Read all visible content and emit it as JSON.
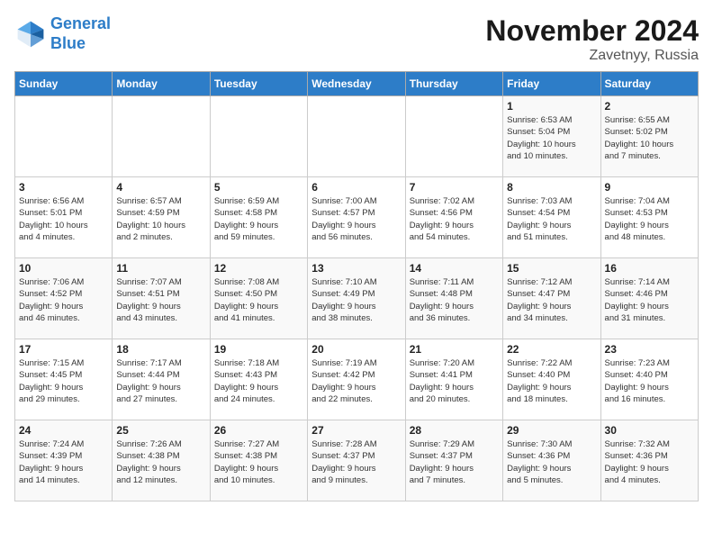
{
  "header": {
    "logo_line1": "General",
    "logo_line2": "Blue",
    "month": "November 2024",
    "location": "Zavetnyy, Russia"
  },
  "weekdays": [
    "Sunday",
    "Monday",
    "Tuesday",
    "Wednesday",
    "Thursday",
    "Friday",
    "Saturday"
  ],
  "weeks": [
    [
      {
        "day": "",
        "info": ""
      },
      {
        "day": "",
        "info": ""
      },
      {
        "day": "",
        "info": ""
      },
      {
        "day": "",
        "info": ""
      },
      {
        "day": "",
        "info": ""
      },
      {
        "day": "1",
        "info": "Sunrise: 6:53 AM\nSunset: 5:04 PM\nDaylight: 10 hours\nand 10 minutes."
      },
      {
        "day": "2",
        "info": "Sunrise: 6:55 AM\nSunset: 5:02 PM\nDaylight: 10 hours\nand 7 minutes."
      }
    ],
    [
      {
        "day": "3",
        "info": "Sunrise: 6:56 AM\nSunset: 5:01 PM\nDaylight: 10 hours\nand 4 minutes."
      },
      {
        "day": "4",
        "info": "Sunrise: 6:57 AM\nSunset: 4:59 PM\nDaylight: 10 hours\nand 2 minutes."
      },
      {
        "day": "5",
        "info": "Sunrise: 6:59 AM\nSunset: 4:58 PM\nDaylight: 9 hours\nand 59 minutes."
      },
      {
        "day": "6",
        "info": "Sunrise: 7:00 AM\nSunset: 4:57 PM\nDaylight: 9 hours\nand 56 minutes."
      },
      {
        "day": "7",
        "info": "Sunrise: 7:02 AM\nSunset: 4:56 PM\nDaylight: 9 hours\nand 54 minutes."
      },
      {
        "day": "8",
        "info": "Sunrise: 7:03 AM\nSunset: 4:54 PM\nDaylight: 9 hours\nand 51 minutes."
      },
      {
        "day": "9",
        "info": "Sunrise: 7:04 AM\nSunset: 4:53 PM\nDaylight: 9 hours\nand 48 minutes."
      }
    ],
    [
      {
        "day": "10",
        "info": "Sunrise: 7:06 AM\nSunset: 4:52 PM\nDaylight: 9 hours\nand 46 minutes."
      },
      {
        "day": "11",
        "info": "Sunrise: 7:07 AM\nSunset: 4:51 PM\nDaylight: 9 hours\nand 43 minutes."
      },
      {
        "day": "12",
        "info": "Sunrise: 7:08 AM\nSunset: 4:50 PM\nDaylight: 9 hours\nand 41 minutes."
      },
      {
        "day": "13",
        "info": "Sunrise: 7:10 AM\nSunset: 4:49 PM\nDaylight: 9 hours\nand 38 minutes."
      },
      {
        "day": "14",
        "info": "Sunrise: 7:11 AM\nSunset: 4:48 PM\nDaylight: 9 hours\nand 36 minutes."
      },
      {
        "day": "15",
        "info": "Sunrise: 7:12 AM\nSunset: 4:47 PM\nDaylight: 9 hours\nand 34 minutes."
      },
      {
        "day": "16",
        "info": "Sunrise: 7:14 AM\nSunset: 4:46 PM\nDaylight: 9 hours\nand 31 minutes."
      }
    ],
    [
      {
        "day": "17",
        "info": "Sunrise: 7:15 AM\nSunset: 4:45 PM\nDaylight: 9 hours\nand 29 minutes."
      },
      {
        "day": "18",
        "info": "Sunrise: 7:17 AM\nSunset: 4:44 PM\nDaylight: 9 hours\nand 27 minutes."
      },
      {
        "day": "19",
        "info": "Sunrise: 7:18 AM\nSunset: 4:43 PM\nDaylight: 9 hours\nand 24 minutes."
      },
      {
        "day": "20",
        "info": "Sunrise: 7:19 AM\nSunset: 4:42 PM\nDaylight: 9 hours\nand 22 minutes."
      },
      {
        "day": "21",
        "info": "Sunrise: 7:20 AM\nSunset: 4:41 PM\nDaylight: 9 hours\nand 20 minutes."
      },
      {
        "day": "22",
        "info": "Sunrise: 7:22 AM\nSunset: 4:40 PM\nDaylight: 9 hours\nand 18 minutes."
      },
      {
        "day": "23",
        "info": "Sunrise: 7:23 AM\nSunset: 4:40 PM\nDaylight: 9 hours\nand 16 minutes."
      }
    ],
    [
      {
        "day": "24",
        "info": "Sunrise: 7:24 AM\nSunset: 4:39 PM\nDaylight: 9 hours\nand 14 minutes."
      },
      {
        "day": "25",
        "info": "Sunrise: 7:26 AM\nSunset: 4:38 PM\nDaylight: 9 hours\nand 12 minutes."
      },
      {
        "day": "26",
        "info": "Sunrise: 7:27 AM\nSunset: 4:38 PM\nDaylight: 9 hours\nand 10 minutes."
      },
      {
        "day": "27",
        "info": "Sunrise: 7:28 AM\nSunset: 4:37 PM\nDaylight: 9 hours\nand 9 minutes."
      },
      {
        "day": "28",
        "info": "Sunrise: 7:29 AM\nSunset: 4:37 PM\nDaylight: 9 hours\nand 7 minutes."
      },
      {
        "day": "29",
        "info": "Sunrise: 7:30 AM\nSunset: 4:36 PM\nDaylight: 9 hours\nand 5 minutes."
      },
      {
        "day": "30",
        "info": "Sunrise: 7:32 AM\nSunset: 4:36 PM\nDaylight: 9 hours\nand 4 minutes."
      }
    ]
  ]
}
